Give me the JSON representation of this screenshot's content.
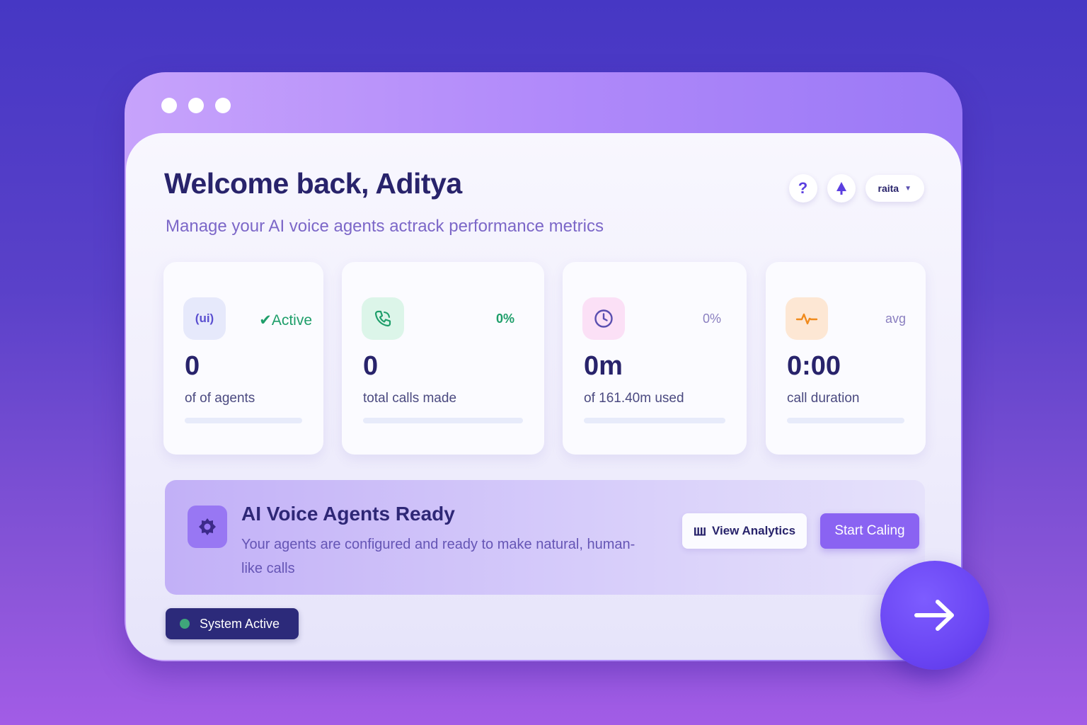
{
  "header": {
    "title": "Welcome back, Aditya",
    "subtitle": "Manage your AI voice agents actrack performance metrics",
    "help_icon": "question-mark-icon",
    "notification_icon": "tree-icon",
    "user_label": "raita",
    "user_chevron": "chevron-down-icon"
  },
  "stats": [
    {
      "icon": "ui-icon",
      "badge": "Active",
      "badge_icon": "checkmark-icon",
      "value": "0",
      "label": "of of agents",
      "accent": "#1e9e6a",
      "icon_bg": "#e6e9fb"
    },
    {
      "icon": "phone-icon",
      "badge": "0%",
      "value": "0",
      "label": "total calls made",
      "accent": "#1e9e6a",
      "icon_bg": "#dcf5e9"
    },
    {
      "icon": "clock-icon",
      "badge": "0%",
      "value": "0m",
      "label": "of 161.40m used",
      "accent": "#8a7fc0",
      "icon_bg": "#fbe0f6"
    },
    {
      "icon": "activity-icon",
      "badge": "avg",
      "value": "0:00",
      "label": "call duration",
      "accent": "#8a7fc0",
      "icon_bg": "#fde7d4"
    }
  ],
  "banner": {
    "icon": "gear-icon",
    "title": "AI Voice Agents Ready",
    "text": "Your agents are configured and ready to make natural, human-like calls",
    "analytics_icon": "bar-chart-icon",
    "analytics_label": "View Analytics",
    "start_label": "Start Caling"
  },
  "status": {
    "label": "System Active",
    "color": "#3fa67a"
  },
  "fab": {
    "icon": "arrow-right-icon"
  },
  "colors": {
    "accent": "#6a45f3",
    "text_dark": "#28236b",
    "subtitle": "#7c67c8"
  }
}
